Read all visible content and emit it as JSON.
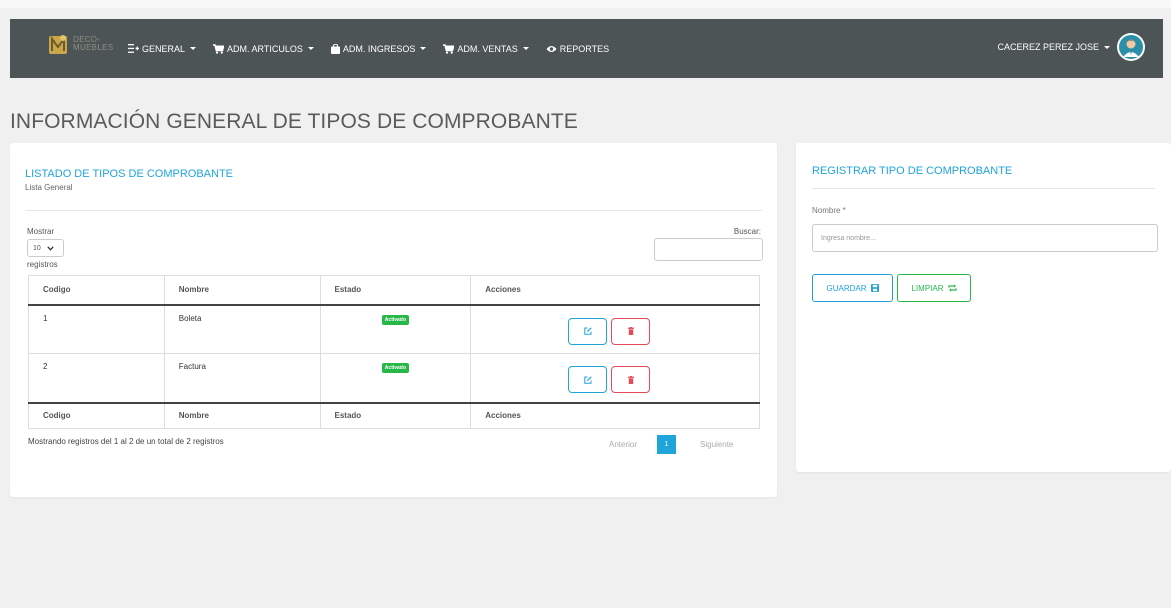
{
  "navbar": {
    "logo_text_line1": "DECO-",
    "logo_text_line2": "MUEBLES",
    "menu": [
      {
        "label": "GENERAL"
      },
      {
        "label": "ADM. ARTICULOS"
      },
      {
        "label": "ADM. INGRESOS"
      },
      {
        "label": "ADM. VENTAS"
      },
      {
        "label": "REPORTES"
      }
    ],
    "user_name": "CACEREZ PEREZ JOSE"
  },
  "page": {
    "title": "INFORMACIÓN GENERAL DE TIPOS DE COMPROBANTE"
  },
  "list_card": {
    "title": "LISTADO DE TIPOS DE COMPROBANTE",
    "subtitle": "Lista General",
    "show_label": "Mostrar",
    "show_value": "10",
    "records_label": "registros",
    "search_label": "Buscar:",
    "columns": [
      "Codigo",
      "Nombre",
      "Estado",
      "Acciones"
    ],
    "rows": [
      {
        "codigo": "1",
        "nombre": "Boleta",
        "estado": "Activado"
      },
      {
        "codigo": "2",
        "nombre": "Factura",
        "estado": "Activado"
      }
    ],
    "info": "Mostrando registros del 1 al 2 de un total de 2 registros",
    "pager": {
      "prev": "Anterior",
      "current": "1",
      "next": "Siguiente"
    }
  },
  "form_card": {
    "title": "REGISTRAR TIPO DE COMPROBANTE",
    "name_label": "Nombre *",
    "name_placeholder": "Ingresa nombre...",
    "save_label": "GUARDAR",
    "clean_label": "LIMPIAR"
  },
  "colors": {
    "navbar": "#4d5455",
    "accent": "#1fa5da",
    "success": "#28b84a",
    "danger": "#e54a5a"
  },
  "icons": {
    "menu_general": "list-plus-icon",
    "menu_articulos": "cart-icon",
    "menu_ingresos": "bag-icon",
    "menu_ventas": "cart-icon",
    "menu_reportes": "eye-icon",
    "edit": "edit-icon",
    "delete": "trash-icon",
    "save": "floppy-icon",
    "clean": "refresh-icon"
  }
}
